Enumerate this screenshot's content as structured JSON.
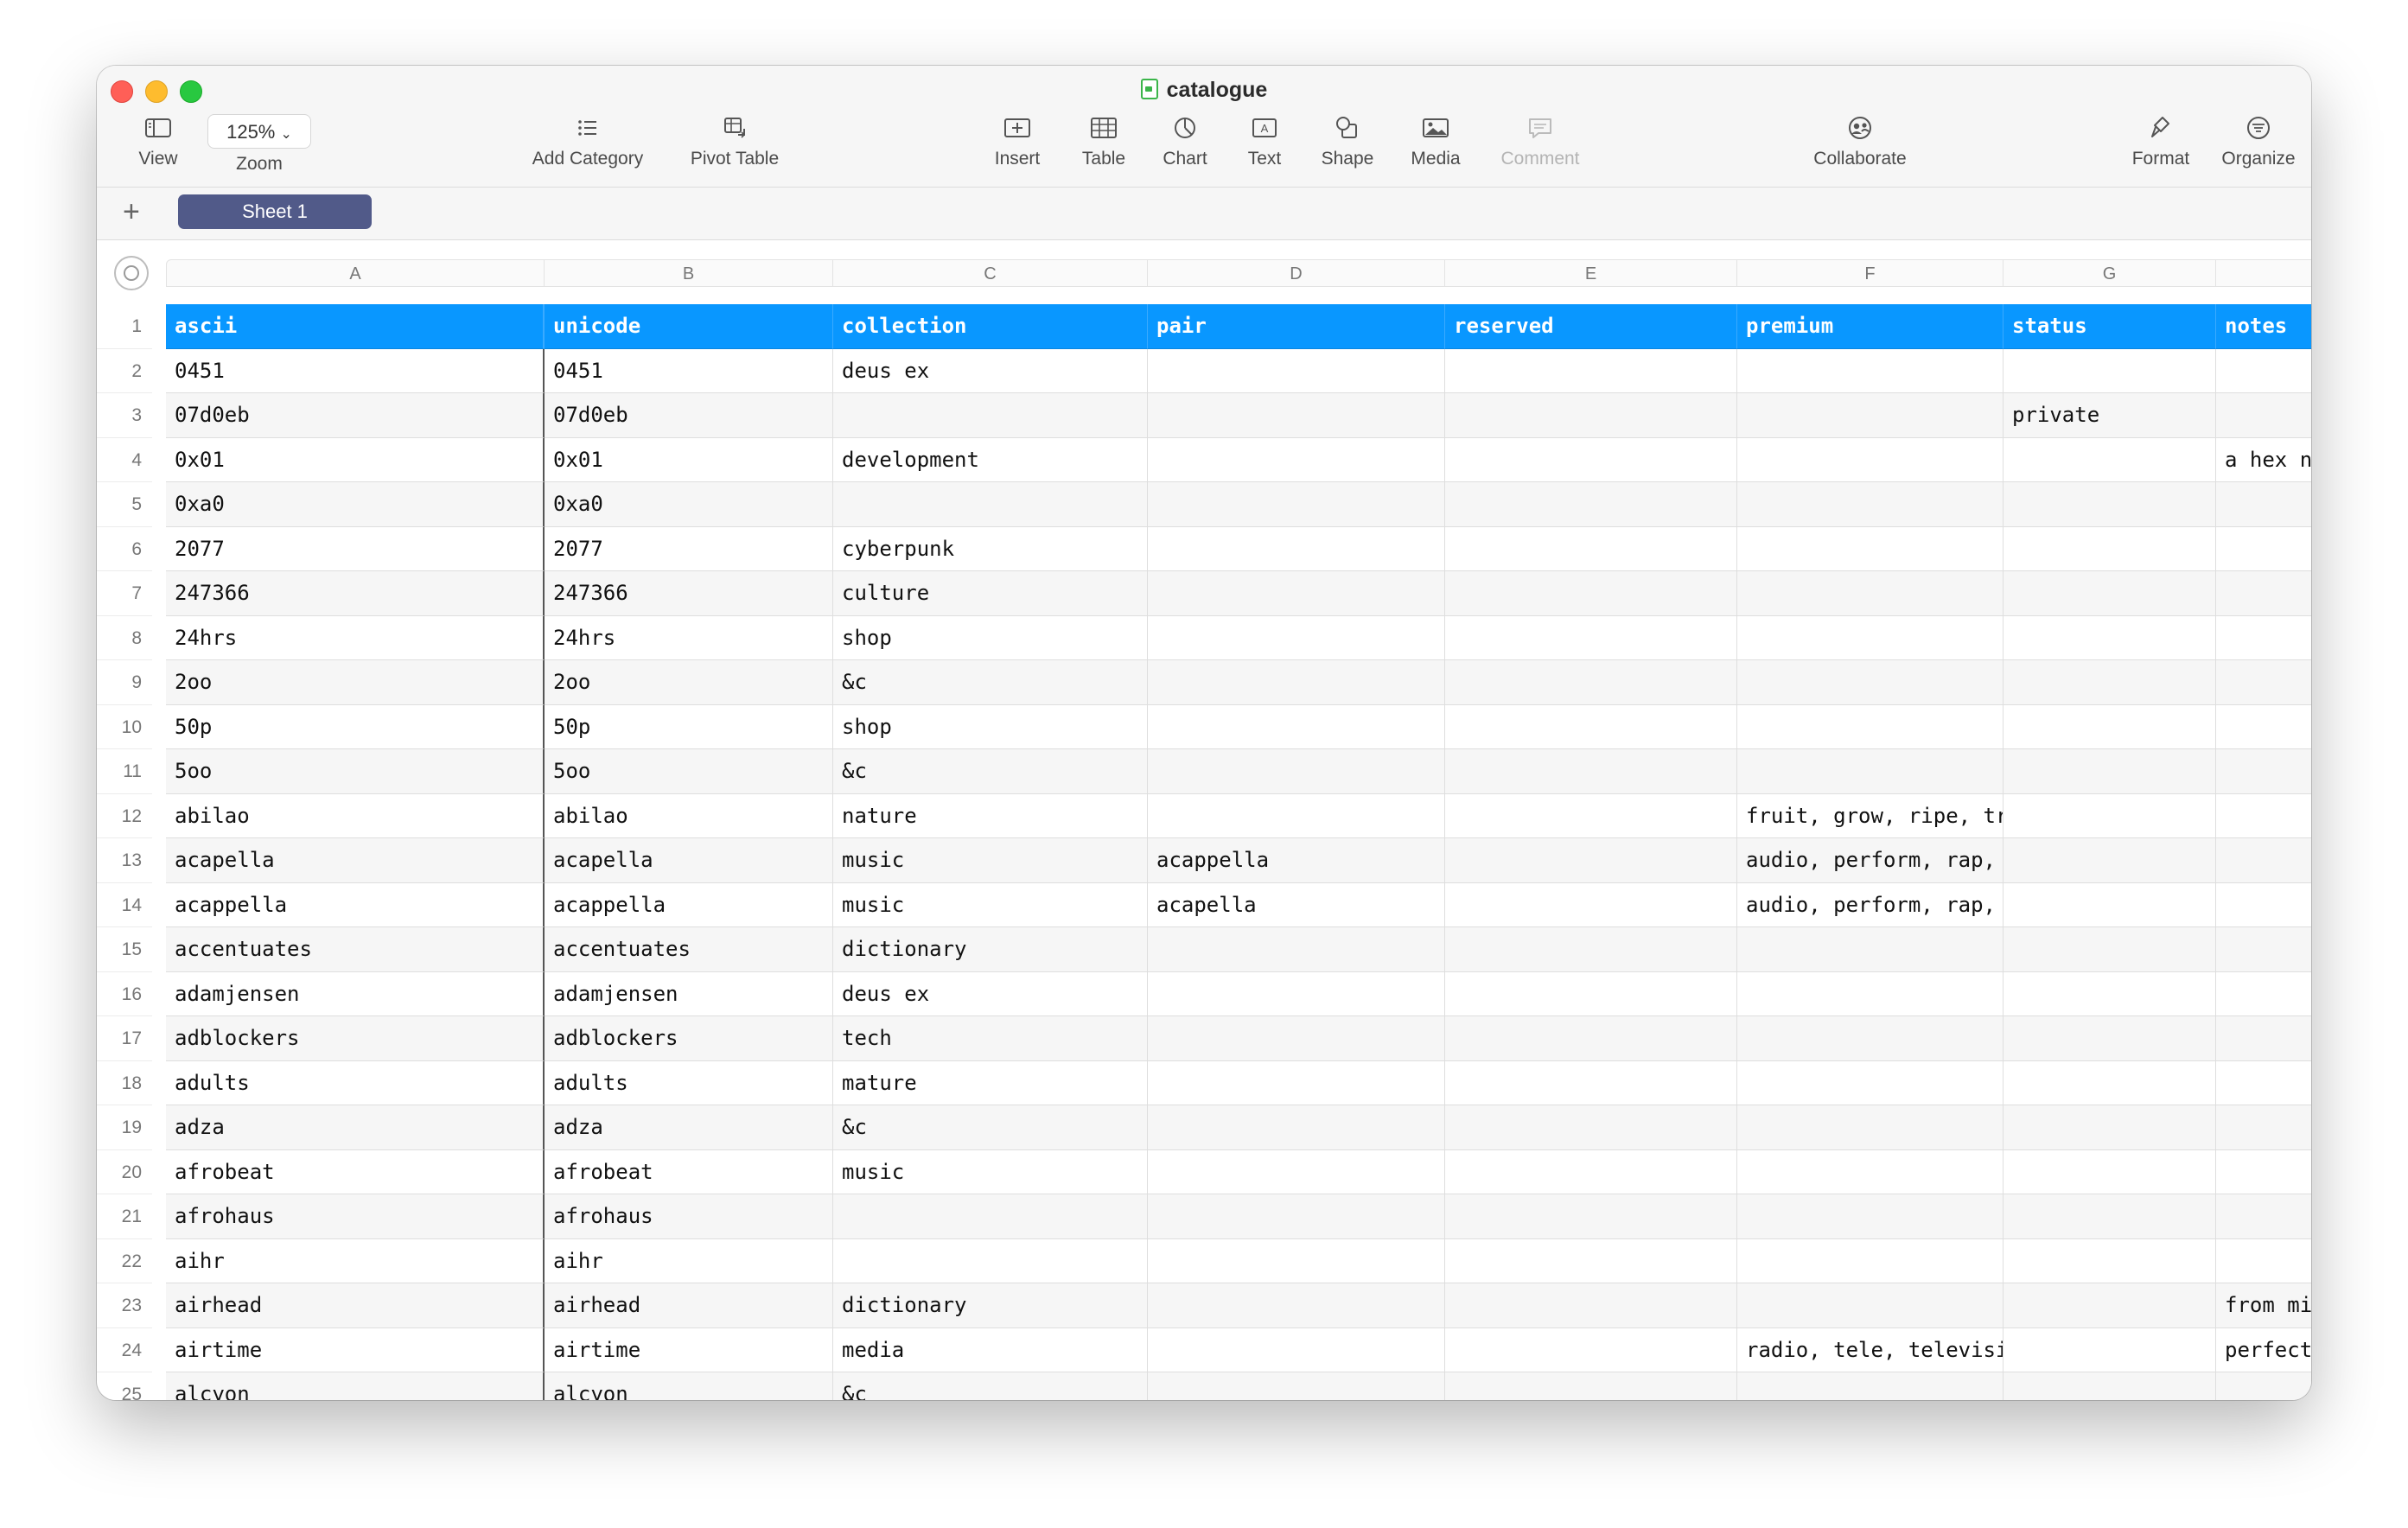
{
  "window": {
    "title": "catalogue"
  },
  "toolbar": {
    "view": "View",
    "zoom_value": "125%",
    "zoom": "Zoom",
    "add_category": "Add Category",
    "pivot_table": "Pivot Table",
    "insert": "Insert",
    "table": "Table",
    "chart": "Chart",
    "text": "Text",
    "shape": "Shape",
    "media": "Media",
    "comment": "Comment",
    "collaborate": "Collaborate",
    "format": "Format",
    "organize": "Organize"
  },
  "sheets": {
    "add": "+",
    "active": "Sheet 1"
  },
  "columns": [
    "A",
    "B",
    "C",
    "D",
    "E",
    "F",
    "G",
    ""
  ],
  "header": [
    "ascii",
    "unicode",
    "collection",
    "pair",
    "reserved",
    "premium",
    "status",
    "notes"
  ],
  "rows": [
    [
      "0451",
      "0451",
      "deus ex",
      "",
      "",
      "",
      "",
      ""
    ],
    [
      "07d0eb",
      "07d0eb",
      "",
      "",
      "",
      "",
      "private",
      ""
    ],
    [
      "0x01",
      "0x01",
      "development",
      "",
      "",
      "",
      "",
      "a hex n"
    ],
    [
      "0xa0",
      "0xa0",
      "",
      "",
      "",
      "",
      "",
      ""
    ],
    [
      "2077",
      "2077",
      "cyberpunk",
      "",
      "",
      "",
      "",
      ""
    ],
    [
      "247366",
      "247366",
      "culture",
      "",
      "",
      "",
      "",
      ""
    ],
    [
      "24hrs",
      "24hrs",
      "shop",
      "",
      "",
      "",
      "",
      ""
    ],
    [
      "2oo",
      "2oo",
      "&c",
      "",
      "",
      "",
      "",
      ""
    ],
    [
      "50p",
      "50p",
      "shop",
      "",
      "",
      "",
      "",
      ""
    ],
    [
      "5oo",
      "5oo",
      "&c",
      "",
      "",
      "",
      "",
      ""
    ],
    [
      "abilao",
      "abilao",
      "nature",
      "",
      "",
      "fruit, grow, ripe, tree",
      "",
      ""
    ],
    [
      "acapella",
      "acapella",
      "music",
      "acappella",
      "",
      "audio, perform, rap, sing",
      "",
      ""
    ],
    [
      "acappella",
      "acappella",
      "music",
      "acapella",
      "",
      "audio, perform, rap, sing",
      "",
      ""
    ],
    [
      "accentuates",
      "accentuates",
      "dictionary",
      "",
      "",
      "",
      "",
      ""
    ],
    [
      "adamjensen",
      "adamjensen",
      "deus ex",
      "",
      "",
      "",
      "",
      ""
    ],
    [
      "adblockers",
      "adblockers",
      "tech",
      "",
      "",
      "",
      "",
      ""
    ],
    [
      "adults",
      "adults",
      "mature",
      "",
      "",
      "",
      "",
      ""
    ],
    [
      "adza",
      "adza",
      "&c",
      "",
      "",
      "",
      "",
      ""
    ],
    [
      "afrobeat",
      "afrobeat",
      "music",
      "",
      "",
      "",
      "",
      ""
    ],
    [
      "afrohaus",
      "afrohaus",
      "",
      "",
      "",
      "",
      "",
      ""
    ],
    [
      "aihr",
      "aihr",
      "",
      "",
      "",
      "",
      "",
      ""
    ],
    [
      "airhead",
      "airhead",
      "dictionary",
      "",
      "",
      "",
      "",
      "from mi"
    ],
    [
      "airtime",
      "airtime",
      "media",
      "",
      "",
      "radio, tele, television, tv",
      "",
      "perfect"
    ],
    [
      "alcyon",
      "alcyon",
      "&c",
      "",
      "",
      "",
      "",
      ""
    ]
  ],
  "row_numbers": [
    "1",
    "2",
    "3",
    "4",
    "5",
    "6",
    "7",
    "8",
    "9",
    "10",
    "11",
    "12",
    "13",
    "14",
    "15",
    "16",
    "17",
    "18",
    "19",
    "20",
    "21",
    "22",
    "23",
    "24",
    "25"
  ]
}
